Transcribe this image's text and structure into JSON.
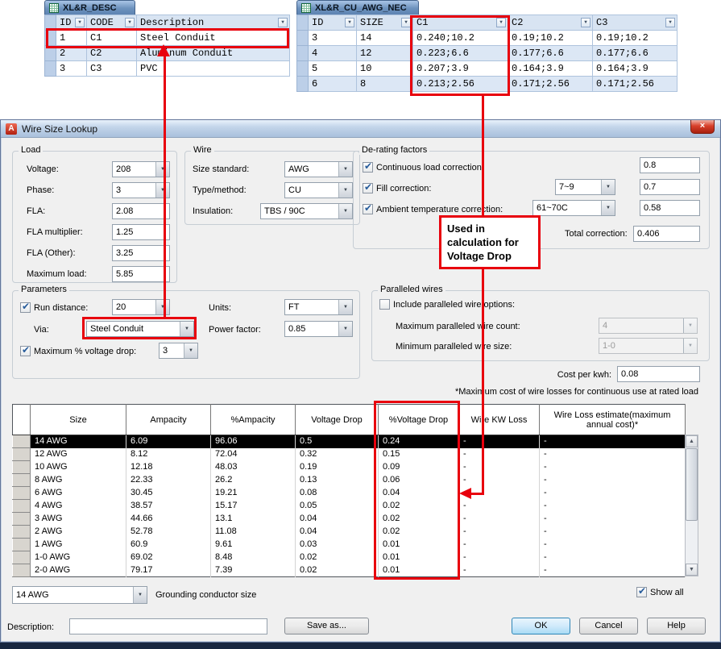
{
  "icons": {
    "close": "×",
    "dropdown": "▼",
    "filter": "▼",
    "scroll_up": "▲",
    "scroll_down": "▼",
    "logo_letter": "A"
  },
  "excel_desc": {
    "title": "XL&R_DESC",
    "columns": [
      "ID",
      "CODE",
      "Description"
    ],
    "rows": [
      [
        "1",
        "C1",
        "Steel Conduit"
      ],
      [
        "2",
        "C2",
        "Aluminum Conduit"
      ],
      [
        "3",
        "C3",
        "PVC"
      ]
    ]
  },
  "excel_awg": {
    "title": "XL&R_CU_AWG_NEC",
    "columns": [
      "ID",
      "SIZE",
      "C1",
      "C2",
      "C3"
    ],
    "rows": [
      [
        "3",
        "14",
        "0.240;10.2",
        "0.19;10.2",
        "0.19;10.2"
      ],
      [
        "4",
        "12",
        "0.223;6.6",
        "0.177;6.6",
        "0.177;6.6"
      ],
      [
        "5",
        "10",
        "0.207;3.9",
        "0.164;3.9",
        "0.164;3.9"
      ],
      [
        "6",
        "8",
        "0.213;2.56",
        "0.171;2.56",
        "0.171;2.56"
      ]
    ]
  },
  "annotation": {
    "note_text": "Used in\ncalculation for\nVoltage Drop",
    "color": "#e8000d"
  },
  "dialog": {
    "title": "Wire Size Lookup",
    "load": {
      "caption": "Load",
      "voltage_label": "Voltage:",
      "voltage_value": "208",
      "phase_label": "Phase:",
      "phase_value": "3",
      "fla_label": "FLA:",
      "fla_value": "2.08",
      "fla_multiplier_label": "FLA multiplier:",
      "fla_multiplier_value": "1.25",
      "fla_other_label": "FLA (Other):",
      "fla_other_value": "3.25",
      "maximum_load_label": "Maximum load:",
      "maximum_load_value": "5.85"
    },
    "wire": {
      "caption": "Wire",
      "size_standard_label": "Size standard:",
      "size_standard_value": "AWG",
      "type_method_label": "Type/method:",
      "type_method_value": "CU",
      "insulation_label": "Insulation:",
      "insulation_value": "TBS / 90C"
    },
    "derating": {
      "caption": "De-rating factors",
      "continuous_label": "Continuous load correction:",
      "continuous_checked": true,
      "continuous_value": "0.8",
      "fill_label": "Fill correction:",
      "fill_checked": true,
      "fill_range": "7~9",
      "fill_value": "0.7",
      "ambient_label": "Ambient temperature correction:",
      "ambient_checked": true,
      "ambient_range": "61~70C",
      "ambient_value": "0.58",
      "total_label": "Total correction:",
      "total_value": "0.406"
    },
    "parameters": {
      "caption": "Parameters",
      "run_distance_label": "Run distance:",
      "run_distance_checked": true,
      "run_distance_value": "20",
      "units_label": "Units:",
      "units_value": "FT",
      "via_label": "Via:",
      "via_value": "Steel Conduit",
      "power_factor_label": "Power factor:",
      "power_factor_value": "0.85",
      "max_vd_label": "Maximum % voltage drop:",
      "max_vd_checked": true,
      "max_vd_value": "3"
    },
    "paralleled": {
      "caption": "Paralleled wires",
      "include_label": "Include paralleled wire options:",
      "include_checked": false,
      "max_count_label": "Maximum paralleled wire count:",
      "max_count_value": "4",
      "min_size_label": "Minimum paralleled wire size:",
      "min_size_value": "1-0"
    },
    "cost_label": "Cost per kwh:",
    "cost_value": "0.08",
    "footnote": "*Maximum cost of wire losses for continuous use at rated load",
    "results": {
      "columns": [
        "Size",
        "Ampacity",
        "%Ampacity",
        "Voltage Drop",
        "%Voltage Drop",
        "Wire KW Loss",
        "Wire Loss estimate(maximum annual cost)*"
      ],
      "rows": [
        [
          "14 AWG",
          "6.09",
          "96.06",
          "0.5",
          "0.24",
          "-",
          "-"
        ],
        [
          "12 AWG",
          "8.12",
          "72.04",
          "0.32",
          "0.15",
          "-",
          "-"
        ],
        [
          "10 AWG",
          "12.18",
          "48.03",
          "0.19",
          "0.09",
          "-",
          "-"
        ],
        [
          "8 AWG",
          "22.33",
          "26.2",
          "0.13",
          "0.06",
          "-",
          "-"
        ],
        [
          "6 AWG",
          "30.45",
          "19.21",
          "0.08",
          "0.04",
          "-",
          "-"
        ],
        [
          "4 AWG",
          "38.57",
          "15.17",
          "0.05",
          "0.02",
          "-",
          "-"
        ],
        [
          "3 AWG",
          "44.66",
          "13.1",
          "0.04",
          "0.02",
          "-",
          "-"
        ],
        [
          "2 AWG",
          "52.78",
          "11.08",
          "0.04",
          "0.02",
          "-",
          "-"
        ],
        [
          "1 AWG",
          "60.9",
          "9.61",
          "0.03",
          "0.01",
          "-",
          "-"
        ],
        [
          "1-0 AWG",
          "69.02",
          "8.48",
          "0.02",
          "0.01",
          "-",
          "-"
        ],
        [
          "2-0 AWG",
          "79.17",
          "7.39",
          "0.02",
          "0.01",
          "-",
          "-"
        ]
      ],
      "selected_row": 0
    },
    "grounding_value": "14 AWG",
    "grounding_label": "Grounding conductor size",
    "show_all_label": "Show all",
    "show_all_checked": true,
    "description_label": "Description:",
    "description_value": "",
    "save_as_label": "Save as...",
    "ok_label": "OK",
    "cancel_label": "Cancel",
    "help_label": "Help"
  }
}
